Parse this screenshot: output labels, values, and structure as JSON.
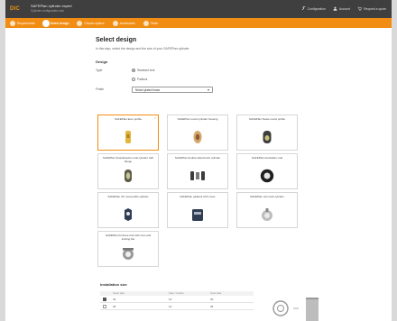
{
  "window": {
    "logo": "DIC",
    "app_title": "SAFEPlan cylinder expert",
    "app_subtitle": "Cylinder configuration tool",
    "actions": [
      {
        "label": "Configuration",
        "icon": "wrench-icon"
      },
      {
        "label": "Account",
        "icon": "user-icon"
      },
      {
        "label": "Request a quote",
        "icon": "cart-icon"
      }
    ]
  },
  "steps": [
    {
      "label": "Requirements",
      "active": false
    },
    {
      "label": "Select design",
      "active": true
    },
    {
      "label": "Choose options",
      "active": false
    },
    {
      "label": "Accessories",
      "active": false
    },
    {
      "label": "Finish",
      "active": false
    }
  ],
  "page": {
    "title": "Select design",
    "intro": "In this step, select the design and the size of your SAFEPlan cylinder."
  },
  "design": {
    "section_title": "Design",
    "type_label": "Type",
    "type_options": [
      {
        "label": "Standard lock",
        "selected": true
      },
      {
        "label": "Padlock",
        "selected": false
      }
    ],
    "finish_label": "Finish",
    "finish_value": "Nickel-plated brass"
  },
  "cards": [
    {
      "label": "SAFEPlan Euro profile",
      "selected": true,
      "icon": "euro-cylinder-icon"
    },
    {
      "label": "SAFEPlan round cylinder housing",
      "selected": false,
      "icon": "round-cylinder-icon"
    },
    {
      "label": "SAFEPlan Swiss round profile",
      "selected": false,
      "icon": "swiss-cylinder-icon"
    },
    {
      "label": "SAFEPlan Scandinavian oval cylinder with flange",
      "selected": false,
      "icon": "oval-cylinder-icon"
    },
    {
      "label": "SAFEPlan double-sided knob cylinder",
      "selected": false,
      "icon": "knob-cylinder-icon"
    },
    {
      "label": "SAFEPlan Australian oval",
      "selected": false,
      "icon": "rim-cylinder-icon"
    },
    {
      "label": "SAFEPlan UK oval profile cylinder",
      "selected": false,
      "icon": "uk-oval-cylinder-icon"
    },
    {
      "label": "SAFEPlan padlock with cover",
      "selected": false,
      "icon": "padlock-icon"
    },
    {
      "label": "SAFEPlan cam lock cylinder",
      "selected": false,
      "icon": "cam-lock-icon"
    },
    {
      "label": "SAFEPlan furniture lock with cam and locking bar",
      "selected": false,
      "icon": "furniture-lock-icon"
    }
  ],
  "installation": {
    "title": "Installation size",
    "columns": [
      "",
      "Outer side",
      "Cam / Centre",
      "Inner side"
    ],
    "rows": [
      {
        "checked": true,
        "outer": "30",
        "centre": "10",
        "inner": "30"
      },
      {
        "checked": false,
        "outer": "35",
        "centre": "10",
        "inner": "35"
      }
    ]
  },
  "colors": {
    "accent": "#f08d12",
    "titlebar": "#3f3f3f"
  }
}
